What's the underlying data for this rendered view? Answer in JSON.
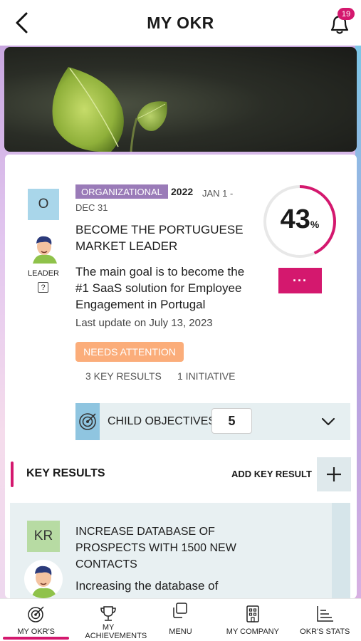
{
  "header": {
    "title": "MY OKR",
    "notification_count": "19"
  },
  "objective": {
    "owner_initial": "O",
    "leader_label": "LEADER",
    "help_glyph": "?",
    "type": "ORGANIZATIONAL",
    "year": "2022",
    "date_range": "JAN 1 - DEC 31",
    "title": "BECOME THE PORTUGUESE MARKET LEADER",
    "description": "The main goal is to become the #1 SaaS solution for Employee Engagement in Portugal",
    "last_update": "Last update on July 13, 2023",
    "progress": 43,
    "progress_value": "43",
    "progress_unit": "%",
    "more_label": "···",
    "status": "NEEDS ATTENTION",
    "key_results_count": "3 KEY RESULTS",
    "initiatives_count": "1 INITIATIVE",
    "child_objectives_label": "CHILD OBJECTIVES",
    "child_objectives_count": "5"
  },
  "key_results": {
    "heading": "KEY RESULTS",
    "add_label": "ADD KEY RESULT",
    "items": [
      {
        "initial": "KR",
        "title": "INCREASE DATABASE OF PROSPECTS WITH 1500 NEW CONTACTS",
        "description": "Increasing the database of"
      }
    ]
  },
  "tabs": [
    {
      "label": "MY OKR'S",
      "icon": "target-icon",
      "active": true
    },
    {
      "label": "MY ACHIEVEMENTS",
      "icon": "trophy-icon",
      "active": false
    },
    {
      "label": "MENU",
      "icon": "windows-icon",
      "active": false
    },
    {
      "label": "MY COMPANY",
      "icon": "building-icon",
      "active": false
    },
    {
      "label": "OKR'S STATS",
      "icon": "bar-chart-icon",
      "active": false
    }
  ],
  "colors": {
    "accent": "#d4186e",
    "status_orange": "#fbad7a",
    "type_tag": "#9a7bb8",
    "owner_blue": "#a9d6ea",
    "kr_green": "#b7dba3"
  }
}
